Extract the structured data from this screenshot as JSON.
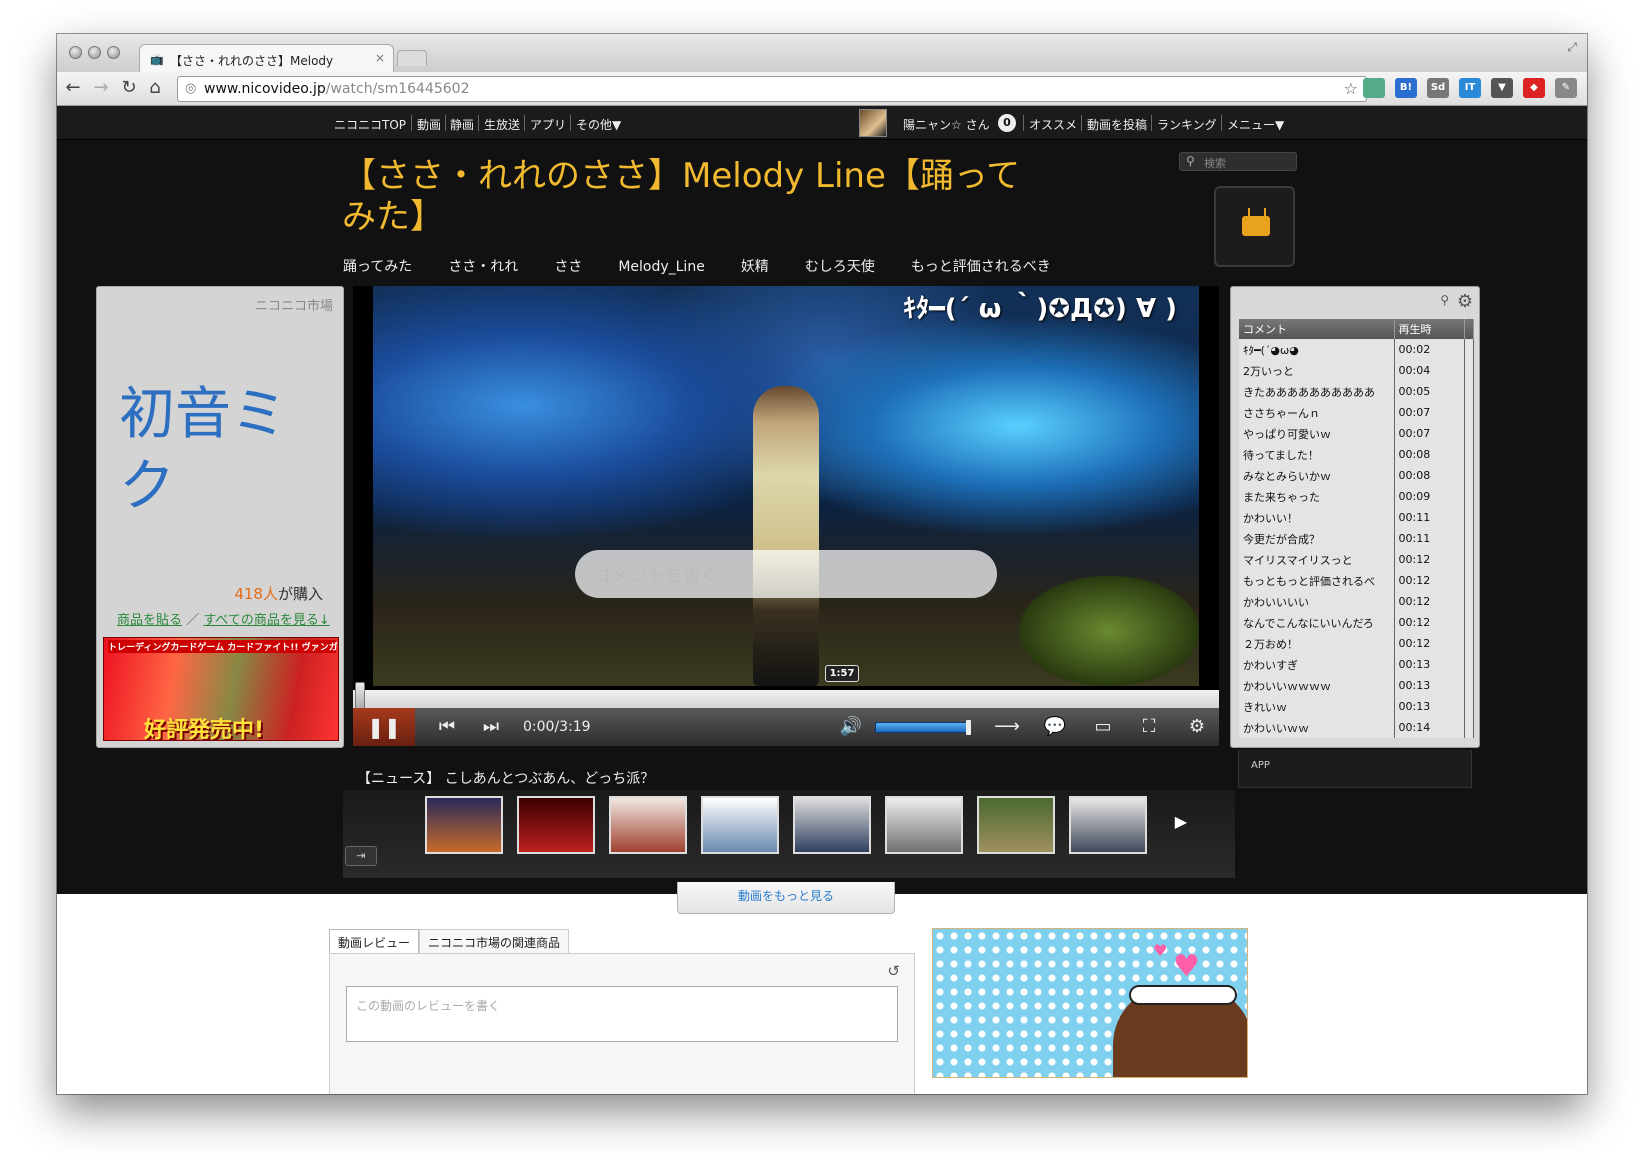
{
  "browser": {
    "tab_title": "【ささ・れれのささ】Melody",
    "tab_close": "×",
    "url_host": "www.nicovideo.jp",
    "url_path": "/watch/sm16445602"
  },
  "nav_left": [
    "ニコニコTOP",
    "動画",
    "静画",
    "生放送",
    "アプリ",
    "その他▼"
  ],
  "user": {
    "name": "陽ニャン☆ さん",
    "count": "0"
  },
  "nav_right": [
    "オススメ",
    "動画を投稿",
    "ランキング",
    "メニュー▼"
  ],
  "search": {
    "placeholder": "検索"
  },
  "video": {
    "title": "【ささ・れれのささ】Melody Line【踊ってみた】",
    "tags": [
      "踊ってみた",
      "ささ・れれ",
      "ささ",
      "Melody_Line",
      "妖精",
      "むしろ天使",
      "もっと評価されるべき"
    ],
    "danmaku": "ｷﾀ━(´ ω ｀)✪Д✪) ∀ )",
    "comment_placeholder": "コメントを書く",
    "hover_time": "1:57",
    "time": "0:00/3:19",
    "progress": 0,
    "volume": 0.95
  },
  "market": {
    "header": "ニコニコ市場",
    "product": "初音ミク",
    "buy_count": "418人",
    "buy_suffix": "が購入",
    "link1": "商品を貼る",
    "slash": "／",
    "link2": "すべての商品を見る↓",
    "ad_line1": "トレーディングカードゲーム カードファイト!! ヴァンガード ©BUSHI illust:NINNIN",
    "ad_line2": "好評発売中!"
  },
  "comments": {
    "col1": "コメント",
    "col2": "再生時",
    "rows": [
      [
        "ｷﾀ━(´◕ω◕",
        "00:02"
      ],
      [
        "2万いっと",
        "00:04"
      ],
      [
        "きたああああああああああ",
        "00:05"
      ],
      [
        "ささちゃーんｎ",
        "00:07"
      ],
      [
        "やっぱり可愛いｗ",
        "00:07"
      ],
      [
        "待ってました！",
        "00:08"
      ],
      [
        "みなとみらいかｗ",
        "00:08"
      ],
      [
        "また来ちゃった",
        "00:09"
      ],
      [
        "かわいい！",
        "00:11"
      ],
      [
        "今更だが合成？",
        "00:11"
      ],
      [
        "マイリスマイリスっと",
        "00:12"
      ],
      [
        "もっともっと評価されるべ",
        "00:12"
      ],
      [
        "かわいいいい",
        "00:12"
      ],
      [
        "なんでこんなにいいんだろ",
        "00:12"
      ],
      [
        "２万おめ！",
        "00:12"
      ],
      [
        "かわいすぎ",
        "00:13"
      ],
      [
        "かわいいｗｗｗｗ",
        "00:13"
      ],
      [
        "きれいｗ",
        "00:13"
      ],
      [
        "かわいいｗｗ",
        "00:14"
      ]
    ]
  },
  "app_label": "APP",
  "news": "【ニュース】 こしあんとつぶあん、どっち派？",
  "more_videos": "動画をもっと見る",
  "review": {
    "tab1": "動画レビュー",
    "tab2": "ニコニコ市場の関連商品",
    "placeholder": "この動画のレビューを書く"
  }
}
